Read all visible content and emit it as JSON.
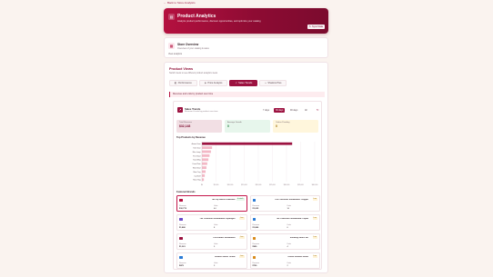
{
  "backlink": {
    "label": "Back to Store Analytics"
  },
  "hero": {
    "title": "Product Analytics",
    "subtitle": "Analyze product performance, discover opportunities, and optimize your catalog",
    "sync_label": "Sync Data"
  },
  "overview": {
    "title": "Store Overview",
    "subtitle": "Overview of your catalog & sales",
    "link": "View analytics"
  },
  "main": {
    "title": "Product Views",
    "subtitle": "Switch views to see different product analytics views",
    "tabs": [
      {
        "label": "Performance",
        "icon": "bar-icon",
        "active": false
      },
      {
        "label": "Price Analysis",
        "icon": "tag-icon",
        "active": false
      },
      {
        "label": "Sales Trends",
        "icon": "trend-icon",
        "active": true
      },
      {
        "label": "Shadow Plus",
        "icon": "plus-icon",
        "active": false
      }
    ],
    "banner": "Revenue and units by product over time"
  },
  "sales_trends": {
    "title": "Sales Trends",
    "subtitle": "Revenue & units by product over time",
    "ranges": [
      "7 days",
      "30 days",
      "90 days",
      "All"
    ],
    "active_range": "30 days",
    "stats": [
      {
        "label": "Total Revenue",
        "value": "$32,148",
        "color": "#f2dfe4",
        "textcolor": "#7b0b2e"
      },
      {
        "label": "Average Growth",
        "value": "0",
        "color": "#e7f6ec",
        "textcolor": "#1e7b3a"
      },
      {
        "label": "Orders Pending",
        "value": "0",
        "color": "#fff6dc",
        "textcolor": "#9a6a00"
      }
    ],
    "chart_heading": "Top Products by Revenue"
  },
  "chart_data": {
    "type": "bar",
    "orientation": "horizontal",
    "categories": [
      "Aurora Vase",
      "Tide Chair",
      "Mica Lamp",
      "Fern Stool",
      "Sand Mug",
      "Dune Plate",
      "Wren Bowl",
      "Slate Tray",
      "Ivy Shelf",
      "Moss Rug"
    ],
    "values": [
      32000,
      3600,
      3200,
      2700,
      2300,
      1900,
      1600,
      1300,
      1000,
      700
    ],
    "xlim": [
      0,
      40000
    ],
    "xticks": [
      "$0",
      "$5,000",
      "$10,000",
      "$15,000",
      "$20,000",
      "$25,000",
      "$30,000",
      "$35,000",
      "$40,000"
    ],
    "grid": true
  },
  "featured": {
    "title": "Featured Brands",
    "products": [
      {
        "name": "The Lip Saffire Guardeck",
        "badge": "In stock",
        "badge_type": "green",
        "icon_color": "#b4103f",
        "l1": "Revenue",
        "v1": "$32,770",
        "l2": "Units",
        "v2": "44"
      },
      {
        "name": "The Collection Snowboard: Oxygen",
        "badge": "Low",
        "badge_type": "amber",
        "icon_color": "#2a7bd6",
        "l1": "Revenue",
        "v1": "$1,025",
        "l2": "Units",
        "v2": "10"
      },
      {
        "name": "The Collection Snowboard: Hydrogen",
        "badge": "Low",
        "badge_type": "amber",
        "icon_color": "#6b4bc8",
        "l1": "Revenue",
        "v1": "$1,880",
        "l2": "Units",
        "v2": "8"
      },
      {
        "name": "The Collection Snowboard: Liquid",
        "badge": "Low",
        "badge_type": "amber",
        "icon_color": "#2a7bd6",
        "l1": "Revenue",
        "v1": "$1,880",
        "l2": "Units",
        "v2": "6"
      },
      {
        "name": "The Hidden Snowboard",
        "badge": "Low",
        "badge_type": "amber",
        "icon_color": "#9c1240",
        "l1": "Revenue",
        "v1": "$1,361",
        "l2": "Units",
        "v2": "5"
      },
      {
        "name": "Snowing Shoes Set",
        "badge": "Low",
        "badge_type": "amber",
        "icon_color": "#d98a1b",
        "l1": "Revenue",
        "v1": "$950",
        "l2": "Units",
        "v2": "4"
      },
      {
        "name": "Leather Stools Yellow",
        "badge": "Low",
        "badge_type": "amber",
        "icon_color": "#2a7bd6",
        "l1": "Revenue",
        "v1": "$875",
        "l2": "Units",
        "v2": "3"
      },
      {
        "name": "Ocean Summer White",
        "badge": "Low",
        "badge_type": "amber",
        "icon_color": "#d98a1b",
        "l1": "Revenue",
        "v1": "$720",
        "l2": "Units",
        "v2": "2"
      }
    ]
  }
}
